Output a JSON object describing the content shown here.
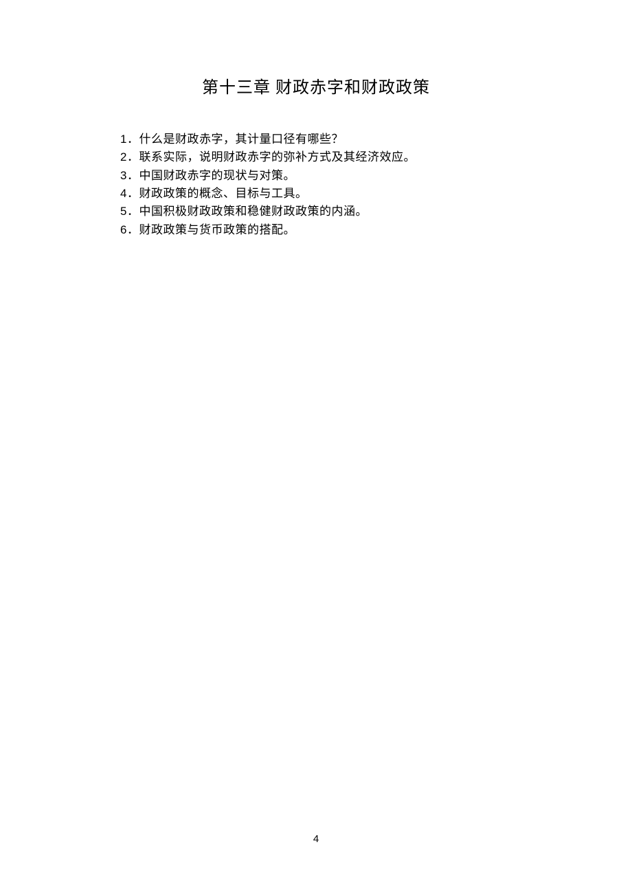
{
  "chapter": {
    "title": "第十三章   财政赤字和财政政策"
  },
  "questions": [
    {
      "num": "1",
      "sep": "．",
      "text": "什么是财政赤字，其计量口径有哪些？"
    },
    {
      "num": "2",
      "sep": "．",
      "text": "联系实际，说明财政赤字的弥补方式及其经济效应。"
    },
    {
      "num": "3",
      "sep": "．",
      "text": "中国财政赤字的现状与对策。"
    },
    {
      "num": "4",
      "sep": "．",
      "text": "财政政策的概念、目标与工具。"
    },
    {
      "num": "5",
      "sep": "．",
      "text": "中国积极财政政策和稳健财政政策的内涵。"
    },
    {
      "num": "6",
      "sep": "．",
      "text": "财政政策与货币政策的搭配。"
    }
  ],
  "page_number": "4"
}
